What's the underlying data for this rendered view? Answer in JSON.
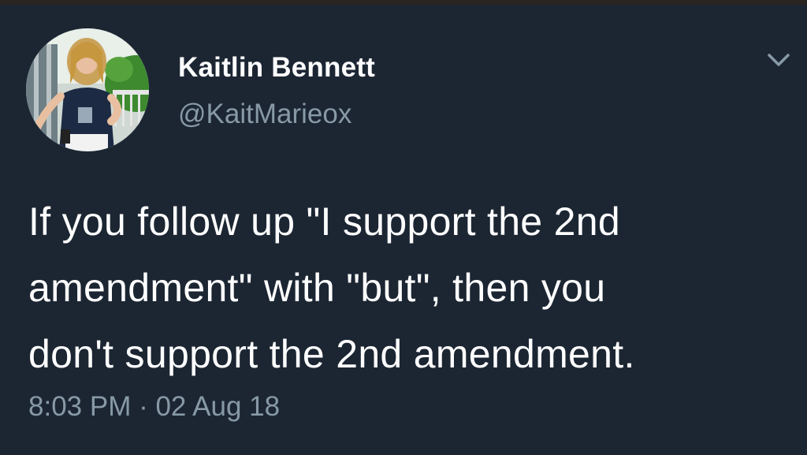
{
  "tweet": {
    "author": {
      "display_name": "Kaitlin Bennett",
      "handle": "@KaitMarieox"
    },
    "text_lines": [
      "If you follow up \"I support the 2nd",
      "amendment\" with \"but\", then you",
      "don't support the 2nd amendment."
    ],
    "timestamp": "8:03 PM · 02 Aug 18",
    "menu_icon": "chevron-down-icon"
  },
  "colors": {
    "background": "#1c2633",
    "primary_text": "#ffffff",
    "secondary_text": "#8899a6"
  }
}
